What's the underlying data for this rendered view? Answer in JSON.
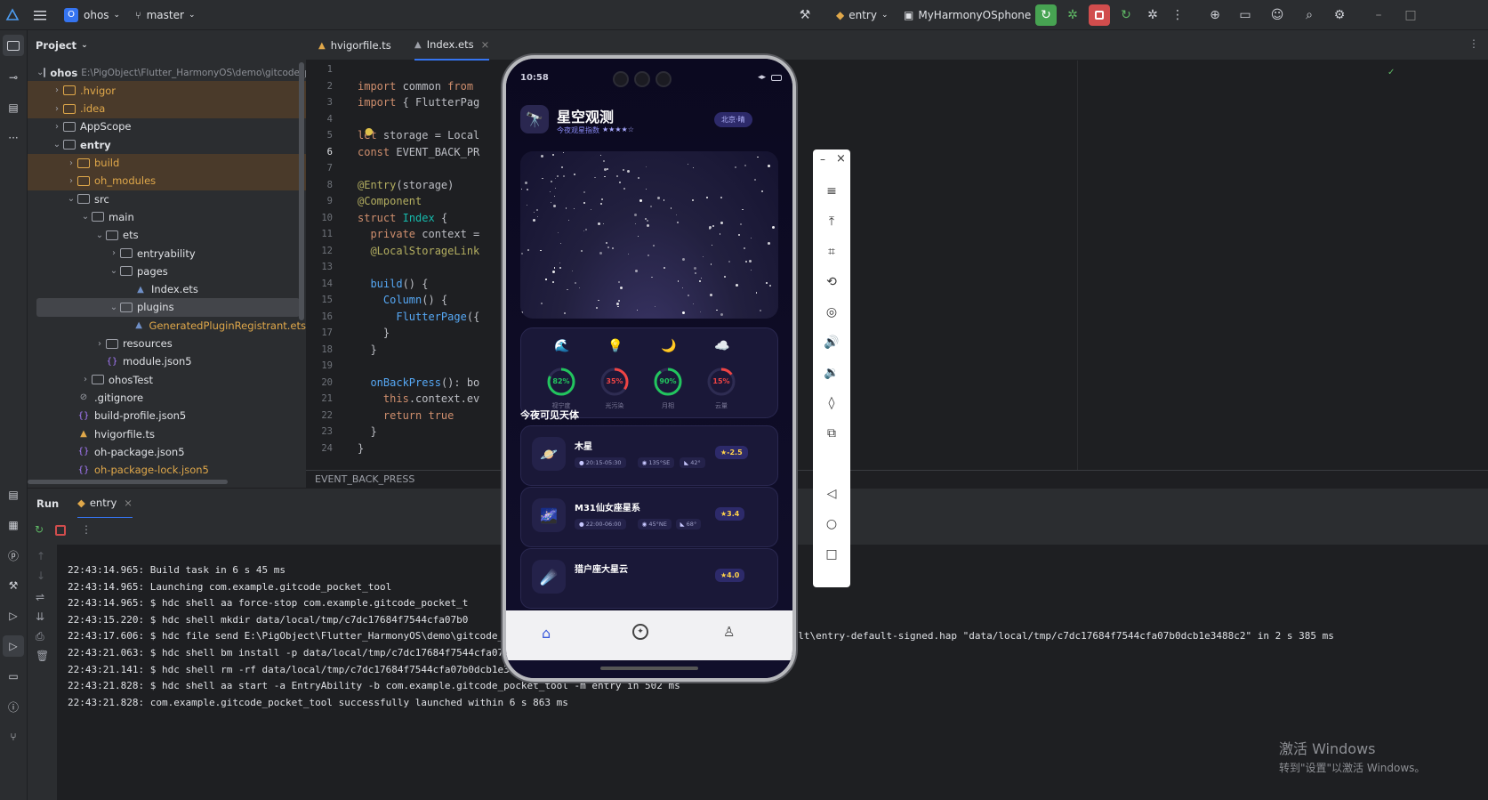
{
  "topbar": {
    "project_badge": "O",
    "project_name": "ohos",
    "branch": "master",
    "run_config": "entry",
    "device": "MyHarmonyOSphone"
  },
  "project_panel": {
    "title": "Project",
    "tree": [
      {
        "label": "ohos",
        "path": "E:\\PigObject\\Flutter_HarmonyOS\\demo\\gitcode_p",
        "indent": 0,
        "open": true,
        "kind": "module"
      },
      {
        "label": ".hvigor",
        "indent": 1,
        "open": false,
        "kind": "folder",
        "excluded": true
      },
      {
        "label": ".idea",
        "indent": 1,
        "open": false,
        "kind": "folder",
        "excluded": true
      },
      {
        "label": "AppScope",
        "indent": 1,
        "open": false,
        "kind": "folder"
      },
      {
        "label": "entry",
        "indent": 1,
        "open": true,
        "kind": "module"
      },
      {
        "label": "build",
        "indent": 2,
        "open": false,
        "kind": "folder",
        "excluded": true
      },
      {
        "label": "oh_modules",
        "indent": 2,
        "open": false,
        "kind": "folder",
        "excluded": true
      },
      {
        "label": "src",
        "indent": 2,
        "open": true,
        "kind": "folder"
      },
      {
        "label": "main",
        "indent": 3,
        "open": true,
        "kind": "folder"
      },
      {
        "label": "ets",
        "indent": 4,
        "open": true,
        "kind": "folder"
      },
      {
        "label": "entryability",
        "indent": 5,
        "open": false,
        "kind": "folder"
      },
      {
        "label": "pages",
        "indent": 5,
        "open": true,
        "kind": "folder"
      },
      {
        "label": "Index.ets",
        "indent": 6,
        "kind": "ets"
      },
      {
        "label": "plugins",
        "indent": 5,
        "open": true,
        "kind": "folder",
        "selected": true
      },
      {
        "label": "GeneratedPluginRegistrant.ets",
        "indent": 6,
        "kind": "ets",
        "modified": true
      },
      {
        "label": "resources",
        "indent": 4,
        "open": false,
        "kind": "folder"
      },
      {
        "label": "module.json5",
        "indent": 4,
        "kind": "json"
      },
      {
        "label": "ohosTest",
        "indent": 3,
        "open": false,
        "kind": "folder"
      },
      {
        "label": ".gitignore",
        "indent": 2,
        "kind": "ignore"
      },
      {
        "label": "build-profile.json5",
        "indent": 2,
        "kind": "json"
      },
      {
        "label": "hvigorfile.ts",
        "indent": 2,
        "kind": "ts"
      },
      {
        "label": "oh-package.json5",
        "indent": 2,
        "kind": "json"
      },
      {
        "label": "oh-package-lock.json5",
        "indent": 2,
        "kind": "json",
        "modified": true
      }
    ]
  },
  "tabs": [
    {
      "label": "hvigorfile.ts"
    },
    {
      "label": "Index.ets",
      "active": true
    }
  ],
  "editor": {
    "lines": [
      {
        "n": "1",
        "html": ""
      },
      {
        "n": "2",
        "html": "<span class='kw'>import</span> common <span class='kw'>from</span>"
      },
      {
        "n": "3",
        "html": "<span class='kw'>import</span> { FlutterPag"
      },
      {
        "n": "4",
        "html": ""
      },
      {
        "n": "5",
        "html": "<span class='kw'>let</span> storage = Local"
      },
      {
        "n": "6",
        "html": "<span class='kw'>const</span> EVENT_BACK_PR"
      },
      {
        "n": "7",
        "html": ""
      },
      {
        "n": "8",
        "html": "<span class='an'>@Entry</span>(storage)"
      },
      {
        "n": "9",
        "html": "<span class='an'>@Component</span>"
      },
      {
        "n": "10",
        "html": "<span class='kw'>struct</span> <span class='cl'>Index</span> {"
      },
      {
        "n": "11",
        "html": "  <span class='kw'>private</span> context ="
      },
      {
        "n": "12",
        "html": "  <span class='an'>@LocalStorageLink</span>"
      },
      {
        "n": "13",
        "html": ""
      },
      {
        "n": "14",
        "html": "  <span class='fn'>build</span>() {"
      },
      {
        "n": "15",
        "html": "    <span class='fn'>Column</span>() {"
      },
      {
        "n": "16",
        "html": "      <span class='fn'>FlutterPage</span>({"
      },
      {
        "n": "17",
        "html": "    }"
      },
      {
        "n": "18",
        "html": "  }"
      },
      {
        "n": "19",
        "html": ""
      },
      {
        "n": "20",
        "html": "  <span class='fn'>onBackPress</span>(): bo"
      },
      {
        "n": "21",
        "html": "    <span class='kw'>this</span>.context.ev"
      },
      {
        "n": "22",
        "html": "    <span class='kw'>return true</span>"
      },
      {
        "n": "23",
        "html": "  }"
      },
      {
        "n": "24",
        "html": "}"
      }
    ],
    "breadcrumb": "EVENT_BACK_PRESS"
  },
  "run": {
    "tab_run": "Run",
    "tab_entry": "entry",
    "console": [
      "22:43:14.965: Build task in 6 s 45 ms",
      "22:43:14.965: Launching com.example.gitcode_pocket_tool",
      "22:43:14.965: $ hdc shell aa force-stop com.example.gitcode_pocket_t",
      "22:43:15.220: $ hdc shell mkdir data/local/tmp/c7dc17684f7544cfa07b0",
      "22:43:17.606: $ hdc file send E:\\PigObject\\Flutter_HarmonyOS\\demo\\gitcode_pocket_tool\\ohos\\entry\\build\\default\\outputs\\default\\entry-default-signed.hap \"data/local/tmp/c7dc17684f7544cfa07b0dcb1e3488c2\" in 2 s 385 ms",
      "22:43:21.063: $ hdc shell bm install -p data/local/tmp/c7dc17684f7544cfa07b0dcb1e3488c2 in 3 s 456 ms",
      "22:43:21.141: $ hdc shell rm -rf data/local/tmp/c7dc17684f7544cfa07b0dcb1e3488c2",
      "22:43:21.828: $ hdc shell aa start -a EntryAbility -b com.example.gitcode_pocket_tool -m entry in 502 ms",
      "22:43:21.828: com.example.gitcode_pocket_tool successfully launched within 6 s 863 ms"
    ]
  },
  "phone": {
    "time": "10:58",
    "title": "星空观测",
    "subtitle": "今夜观星指数",
    "rating_stars": "★★★★☆",
    "location_badge": "北京·晴",
    "metrics": [
      {
        "label": "视宁度",
        "value": "82%",
        "level": 0.82,
        "color": "#22c55e",
        "icon": "🌊"
      },
      {
        "label": "光污染",
        "value": "35%",
        "level": 0.35,
        "color": "#ef4444",
        "icon": "💡"
      },
      {
        "label": "月相",
        "value": "90%",
        "level": 0.9,
        "color": "#22c55e",
        "icon": "🌙"
      },
      {
        "label": "云量",
        "value": "15%",
        "level": 0.15,
        "color": "#ef4444",
        "icon": "☁️"
      }
    ],
    "section_title": "今夜可见天体",
    "objects": [
      {
        "name": "木星",
        "time": "20:15-05:30",
        "direction": "135°SE",
        "altitude": "42°",
        "magnitude": "-2.5",
        "icon": "🪐"
      },
      {
        "name": "M31仙女座星系",
        "time": "22:00-06:00",
        "direction": "45°NE",
        "altitude": "68°",
        "magnitude": "3.4",
        "icon": "🌌"
      },
      {
        "name": "猎户座大星云",
        "time": "",
        "direction": "",
        "altitude": "",
        "magnitude": "4.0",
        "icon": "☄️"
      }
    ],
    "nav": [
      "home-icon",
      "compass-icon",
      "profile-icon"
    ]
  },
  "watermark": {
    "line1": "激活 Windows",
    "line2": "转到\"设置\"以激活 Windows。"
  }
}
